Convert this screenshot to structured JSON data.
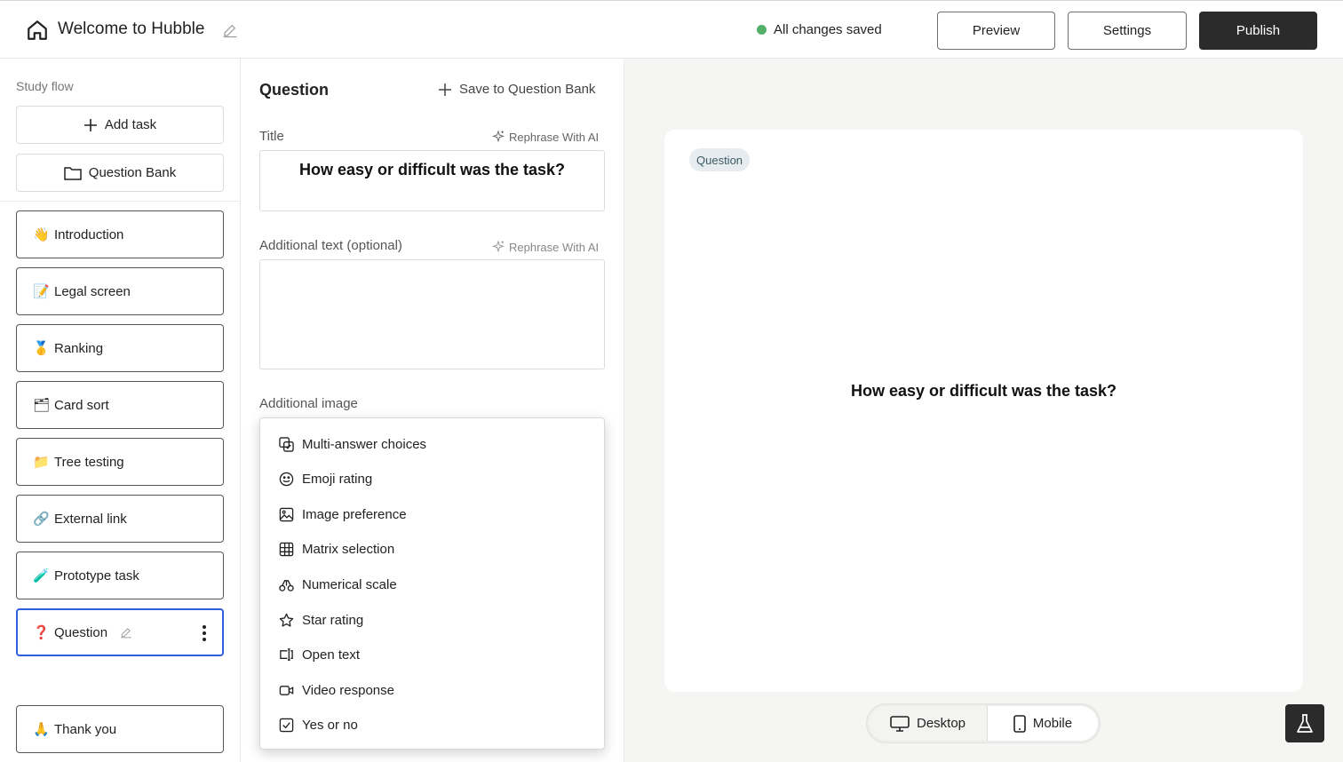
{
  "header": {
    "title": "Welcome to Hubble",
    "status": "All changes saved",
    "preview_label": "Preview",
    "settings_label": "Settings",
    "publish_label": "Publish",
    "status_color": "#52b06a"
  },
  "sidebar": {
    "label": "Study flow",
    "add_task": "Add task",
    "question_bank": "Question Bank",
    "tasks": [
      {
        "emoji": "👋",
        "label": "Introduction"
      },
      {
        "emoji": "📝",
        "label": "Legal screen"
      },
      {
        "emoji": "🥇",
        "label": "Ranking"
      },
      {
        "emoji": "🗂",
        "label": "Card sort"
      },
      {
        "emoji": "📁",
        "label": "Tree testing"
      },
      {
        "emoji": "🔗",
        "label": "External link"
      },
      {
        "emoji": "🧪",
        "label": "Prototype task"
      },
      {
        "emoji": "❓",
        "label": "Question"
      },
      {
        "emoji": "🙏",
        "label": "Thank you"
      }
    ],
    "active_task_color": "#2f5fe0"
  },
  "editor": {
    "heading": "Question",
    "save_to_bank": "Save to Question Bank",
    "title_label": "Title",
    "rephrase": "Rephrase With AI",
    "title_value": "How easy or difficult was the task?",
    "additional_text_label": "Additional text (optional)",
    "additional_image_label": "Additional image"
  },
  "dropdown": {
    "items": [
      {
        "icon": "multi-answer-icon",
        "label": "Multi-answer choices"
      },
      {
        "icon": "smiley-icon",
        "label": "Emoji rating"
      },
      {
        "icon": "image-icon",
        "label": "Image preference"
      },
      {
        "icon": "grid-icon",
        "label": "Matrix selection"
      },
      {
        "icon": "scale-icon",
        "label": "Numerical scale"
      },
      {
        "icon": "star-icon",
        "label": "Star rating"
      },
      {
        "icon": "text-cursor-icon",
        "label": "Open text"
      },
      {
        "icon": "video-icon",
        "label": "Video response"
      },
      {
        "icon": "checkbox-icon",
        "label": "Yes or no"
      }
    ]
  },
  "preview": {
    "badge": "Question",
    "question": "How easy or difficult was the task?",
    "desktop_label": "Desktop",
    "mobile_label": "Mobile"
  }
}
